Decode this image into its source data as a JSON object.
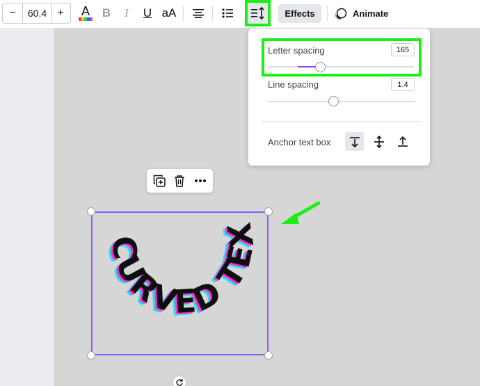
{
  "toolbar": {
    "font_size": "60.4",
    "minus_label": "−",
    "plus_label": "+",
    "text_color_label": "A",
    "bold_label": "B",
    "italic_label": "I",
    "underline_label": "U",
    "case_label": "aA",
    "effects_label": "Effects",
    "animate_label": "Animate",
    "rainbow_colors": [
      "#ff3b30",
      "#ffcc00",
      "#34c759",
      "#007aff",
      "#af52de"
    ]
  },
  "spacing_panel": {
    "letter_spacing_label": "Letter spacing",
    "letter_spacing_value": "165",
    "letter_spacing_fraction": 0.36,
    "line_spacing_label": "Line spacing",
    "line_spacing_value": "1.4",
    "line_spacing_fraction": 0.45,
    "anchor_label": "Anchor text box",
    "anchor_options": [
      "anchor-top",
      "anchor-middle",
      "anchor-bottom"
    ],
    "anchor_selected": "anchor-top"
  },
  "canvas": {
    "curved_text": "CURVED TEXT",
    "text_color": "#0e0e0e",
    "shadow_magenta": "#ff2bd6",
    "shadow_cyan": "#22e3f0"
  },
  "colors": {
    "highlight": "#1bef16",
    "selection": "#8b5cf6",
    "slider_fill": "#8b3dff"
  }
}
